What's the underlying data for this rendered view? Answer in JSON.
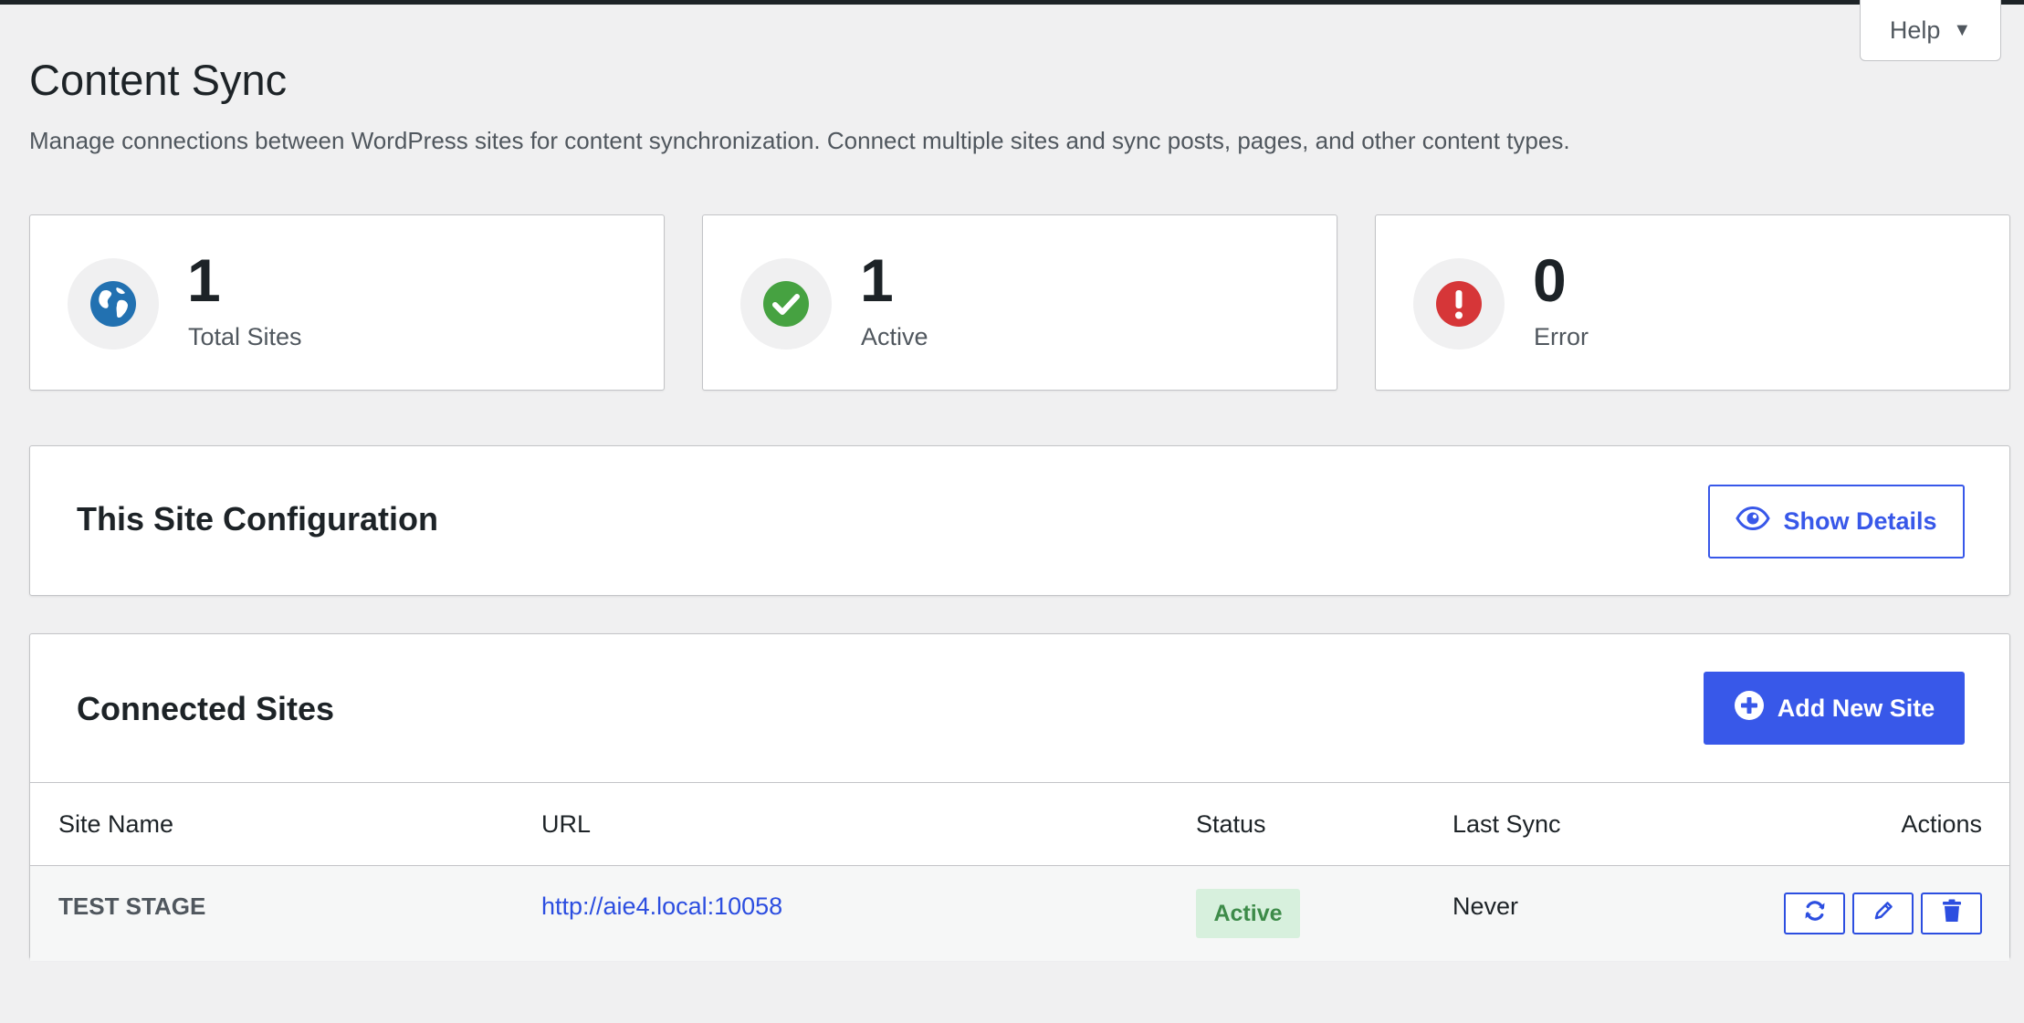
{
  "help": {
    "label": "Help"
  },
  "header": {
    "title": "Content Sync",
    "description": "Manage connections between WordPress sites for content synchronization. Connect multiple sites and sync posts, pages, and other content types."
  },
  "stats": [
    {
      "value": "1",
      "label": "Total Sites",
      "icon": "globe-icon",
      "color": "#2271b1"
    },
    {
      "value": "1",
      "label": "Active",
      "icon": "check-circle-icon",
      "color": "#46a241"
    },
    {
      "value": "0",
      "label": "Error",
      "icon": "alert-circle-icon",
      "color": "#d63638"
    }
  ],
  "config_panel": {
    "title": "This Site Configuration",
    "button_label": "Show Details"
  },
  "sites_panel": {
    "title": "Connected Sites",
    "add_button_label": "Add New Site",
    "columns": [
      "Site Name",
      "URL",
      "Status",
      "Last Sync",
      "Actions"
    ],
    "rows": [
      {
        "name": "TEST STAGE",
        "url": "http://aie4.local:10058",
        "status": "Active",
        "last_sync": "Never"
      }
    ]
  },
  "colors": {
    "accent": "#3858e9",
    "background": "#f0f0f1",
    "active_badge_bg": "#d7f0dd",
    "active_badge_text": "#3d8b49"
  }
}
